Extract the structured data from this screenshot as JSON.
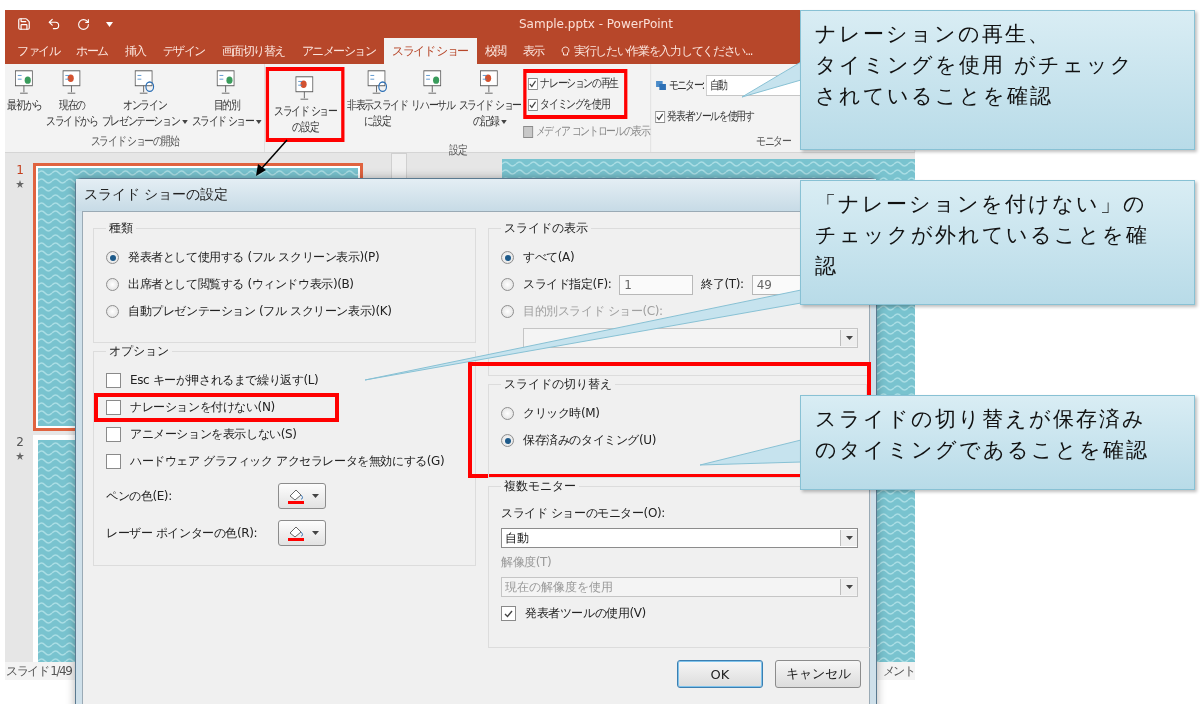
{
  "powerpoint": {
    "title": "Sample.pptx - PowerPoint",
    "tabs": [
      {
        "label": "ファイル",
        "selected": false
      },
      {
        "label": "ホーム",
        "selected": false
      },
      {
        "label": "挿入",
        "selected": false
      },
      {
        "label": "デザイン",
        "selected": false
      },
      {
        "label": "画面切り替え",
        "selected": false
      },
      {
        "label": "アニメーション",
        "selected": false
      },
      {
        "label": "スライド ショー",
        "selected": true
      },
      {
        "label": "校閲",
        "selected": false
      },
      {
        "label": "表示",
        "selected": false
      }
    ],
    "tell_me": "実行したい作業を入力してください...",
    "ribbon": {
      "start_group": {
        "label": "スライド ショーの開始",
        "buttons": [
          {
            "lines": [
              "最初から"
            ],
            "dropdown": false,
            "highlighted": false
          },
          {
            "lines": [
              "現在の",
              "スライドから"
            ],
            "dropdown": false,
            "highlighted": false
          },
          {
            "lines": [
              "オンライン",
              "プレゼンテーション"
            ],
            "dropdown": true,
            "highlighted": false
          },
          {
            "lines": [
              "目的別",
              "スライド ショー"
            ],
            "dropdown": true,
            "highlighted": false
          }
        ]
      },
      "setup_group": {
        "label": "設定",
        "buttons": [
          {
            "lines": [
              "スライド ショー",
              "の設定"
            ],
            "dropdown": false,
            "highlighted": true
          },
          {
            "lines": [
              "非表示スライド",
              "に設定"
            ],
            "dropdown": false,
            "highlighted": false
          },
          {
            "lines": [
              "リハーサル"
            ],
            "dropdown": false,
            "highlighted": false
          },
          {
            "lines": [
              "スライド ショー",
              "の記録"
            ],
            "dropdown": true,
            "highlighted": false
          }
        ],
        "checkboxes": [
          {
            "label": "ナレーションの再生",
            "checked": true,
            "disabled": false,
            "highlighted": true
          },
          {
            "label": "タイミングを使用",
            "checked": true,
            "disabled": false,
            "highlighted": true
          },
          {
            "label": "メディア コントロールの表示",
            "checked": false,
            "disabled": true,
            "highlighted": false
          }
        ]
      },
      "monitor_group": {
        "label": "モニター",
        "monitor_label": "モニター:",
        "monitor_value": "自動",
        "presenter_view": {
          "label": "発表者ツールを使用す",
          "checked": true
        }
      }
    },
    "slides": [
      {
        "number": "1",
        "selected": true
      },
      {
        "number": "2",
        "selected": false
      }
    ],
    "status_bar": {
      "slide_count": "スライド 1/49",
      "comments": "メント"
    }
  },
  "dialog": {
    "title": "スライド ショーの設定",
    "show_type": {
      "title": "種類",
      "highlighted": false,
      "options": [
        {
          "label": "発表者として使用する (フル スクリーン表示)(P)",
          "selected": true
        },
        {
          "label": "出席者として閲覧する (ウィンドウ表示)(B)",
          "selected": false
        },
        {
          "label": "自動プレゼンテーション (フル スクリーン表示)(K)",
          "selected": false
        }
      ]
    },
    "options": {
      "title": "オプション",
      "highlighted": false,
      "checkboxes": [
        {
          "label": "Esc キーが押されるまで繰り返す(L)",
          "checked": false,
          "highlighted": false
        },
        {
          "label": "ナレーションを付けない(N)",
          "checked": false,
          "highlighted": true
        },
        {
          "label": "アニメーションを表示しない(S)",
          "checked": false,
          "highlighted": false
        },
        {
          "label": "ハードウェア グラフィック アクセラレータを無効にする(G)",
          "checked": false,
          "highlighted": false
        }
      ],
      "colors": [
        {
          "label": "ペンの色(E):"
        },
        {
          "label": "レーザー ポインターの色(R):"
        }
      ]
    },
    "show_slides": {
      "title": "スライドの表示",
      "highlighted": false,
      "options": [
        {
          "kind": "all",
          "label": "すべて(A)",
          "selected": true,
          "disabled": false
        },
        {
          "kind": "range",
          "label": "スライド指定(F):",
          "selected": false,
          "disabled": false,
          "from": "1",
          "to_label": "終了(T):",
          "to": "49"
        },
        {
          "kind": "custom",
          "label": "目的別スライド ショー(C):",
          "selected": false,
          "disabled": true
        }
      ]
    },
    "advance": {
      "title": "スライドの切り替え",
      "highlighted": true,
      "options": [
        {
          "label": "クリック時(M)",
          "selected": false
        },
        {
          "label": "保存済みのタイミング(U)",
          "selected": true
        }
      ]
    },
    "monitors": {
      "title": "複数モニター",
      "highlighted": false,
      "monitor_label": "スライド ショーのモニター(O):",
      "monitor_value": "自動",
      "resolution_label": "解像度(T)",
      "resolution_value": "現在の解像度を使用",
      "resolution_disabled": true,
      "presenter_view": {
        "label": "発表者ツールの使用(V)",
        "checked": true
      }
    },
    "buttons": [
      {
        "label": "OK",
        "default": true
      },
      {
        "label": "キャンセル",
        "default": false
      }
    ]
  },
  "callouts": [
    {
      "lines": [
        "ナレーションの再生、",
        "タイミングを使用 がチェック",
        "されていることを確認"
      ]
    },
    {
      "lines": [
        "「ナレーションを付けない」の",
        "チェックが外れていることを確",
        "認"
      ]
    },
    {
      "lines": [
        "スライドの切り替えが保存済み",
        "のタイミングであることを確認"
      ]
    }
  ]
}
